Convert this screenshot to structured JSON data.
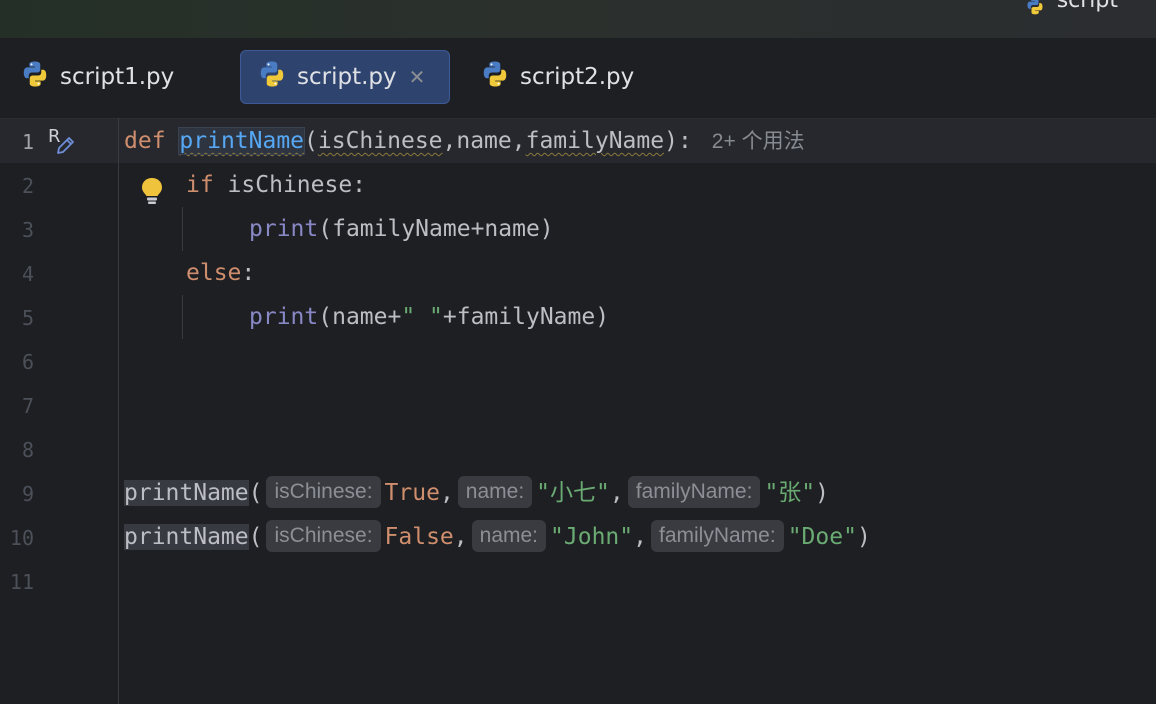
{
  "window": {
    "title": "script"
  },
  "tabs": [
    {
      "label": "script1.py",
      "active": false,
      "icon": "python-icon"
    },
    {
      "label": "script.py",
      "active": true,
      "icon": "python-icon",
      "close": "✕"
    },
    {
      "label": "script2.py",
      "active": false,
      "icon": "python-icon"
    }
  ],
  "gutter": {
    "line_numbers": [
      "1",
      "2",
      "3",
      "4",
      "5",
      "6",
      "7",
      "8",
      "9",
      "10",
      "11"
    ],
    "current_line": "1",
    "vcs_marker": "R"
  },
  "code": {
    "line1": {
      "kw": "def",
      "fn": "printName",
      "open": "(",
      "p1": "isChinese",
      "c1": ",name,",
      "p3": "familyName",
      "close": "):",
      "usages": "2+ 个用法"
    },
    "line2": {
      "kw": "if",
      "rest": " isChinese:"
    },
    "line3": {
      "builtin": "print",
      "rest": "(familyName+name)"
    },
    "line4": {
      "kw": "else",
      "rest": ":"
    },
    "line5": {
      "builtin": "print",
      "a": "(name+",
      "str": "\" \"",
      "b": "+familyName)"
    },
    "line9": {
      "fn": "printName",
      "open": "(",
      "h1": "isChinese:",
      "v1": "True",
      "s1": ",",
      "h2": "name:",
      "v2": "\"小七\"",
      "s2": ",",
      "h3": "familyName:",
      "v3": "\"张\"",
      "close": ")"
    },
    "line10": {
      "fn": "printName",
      "open": "(",
      "h1": "isChinese:",
      "v1": "False",
      "s1": ",",
      "h2": "name:",
      "v2": "\"John\"",
      "s2": ",",
      "h3": "familyName:",
      "v3": "\"Doe\"",
      "close": ")"
    }
  },
  "colors": {
    "background": "#1e1f22",
    "keyword": "#cf8e6d",
    "function": "#56a8f5",
    "builtin": "#8888c6",
    "string": "#6aab73",
    "active_tab": "#2e436e"
  }
}
